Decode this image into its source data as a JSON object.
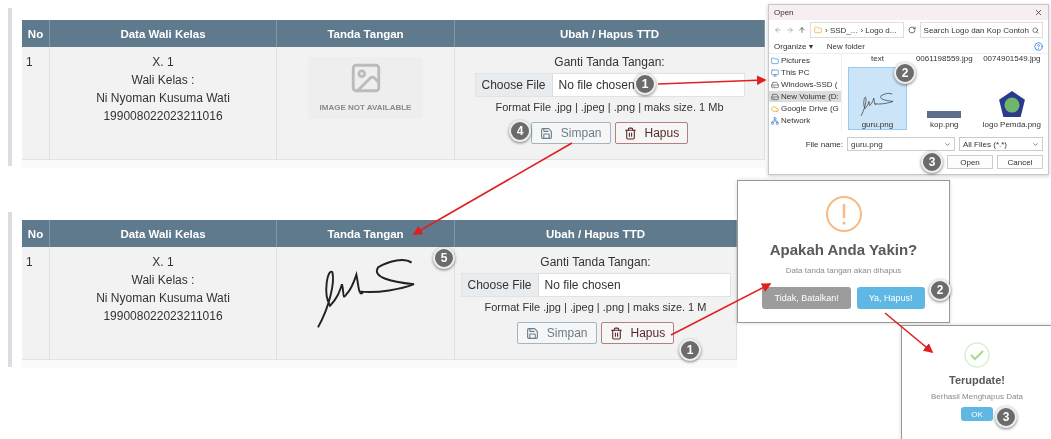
{
  "tables": [
    {
      "columns": [
        "No",
        "Data Wali Kelas",
        "Tanda Tangan",
        "Ubah / Hapus TTD"
      ],
      "rows": [
        {
          "no": "1",
          "lines": [
            "X. 1",
            "Wali Kelas :",
            "Ni Nyoman Kusuma Wati",
            "199008022023211016"
          ],
          "signature": {
            "kind": "placeholder",
            "text": "IMAGE NOT AVAILABLE"
          },
          "upload": {
            "label": "Ganti Tanda Tangan:",
            "button": "Choose File",
            "value": "No file chosen",
            "hint": "Format File .jpg | .jpeg | .png | maks size. 1 Mb"
          },
          "actions": [
            {
              "kind": "save",
              "label": "Simpan"
            },
            {
              "kind": "delete",
              "label": "Hapus"
            }
          ]
        }
      ]
    },
    {
      "columns": [
        "No",
        "Data Wali Kelas",
        "Tanda Tangan",
        "Ubah / Hapus TTD"
      ],
      "rows": [
        {
          "no": "1",
          "lines": [
            "X. 1",
            "Wali Kelas :",
            "Ni Nyoman Kusuma Wati",
            "199008022023211016"
          ],
          "signature": {
            "kind": "image"
          },
          "upload": {
            "label": "Ganti Tanda Tangan:",
            "button": "Choose File",
            "value": "No file chosen",
            "hint": "Format File .jpg | .jpeg | .png | maks size. 1 M"
          },
          "actions": [
            {
              "kind": "save",
              "label": "Simpan"
            },
            {
              "kind": "delete",
              "label": "Hapus"
            }
          ]
        }
      ]
    }
  ],
  "file_dialog": {
    "title": "Open",
    "path": [
      "› SSD_...",
      "› Logo d..."
    ],
    "search": {
      "placeholder": "Search Logo dan Kop Contoh"
    },
    "organize": "Organize ▾",
    "new_folder": "New folder",
    "sidebar": [
      {
        "label": "Pictures",
        "kind": "folder",
        "selected": false
      },
      {
        "label": "This PC",
        "kind": "pc",
        "selected": false
      },
      {
        "label": "Windows-SSD (",
        "kind": "drive",
        "selected": false
      },
      {
        "label": "New Volume (D:",
        "kind": "drive",
        "selected": true
      },
      {
        "label": "Google Drive (G",
        "kind": "cloud",
        "selected": false
      },
      {
        "label": "Network",
        "kind": "network",
        "selected": false
      }
    ],
    "top_labels": [
      "text",
      "0061198559.jpg",
      "0074901549.jpg"
    ],
    "files": [
      {
        "name": "guru.png",
        "kind": "signature",
        "selected": true
      },
      {
        "name": "kop.png",
        "kind": "banner",
        "selected": false
      },
      {
        "name": "logo Pemda.png",
        "kind": "emblem",
        "selected": false
      }
    ],
    "file_name_label": "File name:",
    "file_name": "guru.png",
    "filter": "All Files (*.*)",
    "buttons": [
      "Open",
      "Cancel"
    ]
  },
  "confirm_dialog": {
    "title": "Apakah Anda Yakin?",
    "text": "Data tanda tangan akan dihapus",
    "buttons": [
      {
        "kind": "cancel",
        "label": "Tidak, Batalkan!"
      },
      {
        "kind": "confirm",
        "label": "Ya, Hapus!"
      }
    ]
  },
  "success_dialog": {
    "title": "Terupdate!",
    "text": "Berhasil Menghapus Data",
    "button": "OK"
  },
  "steps": [
    "1",
    "2",
    "3",
    "4",
    "5",
    "1",
    "2",
    "3"
  ]
}
